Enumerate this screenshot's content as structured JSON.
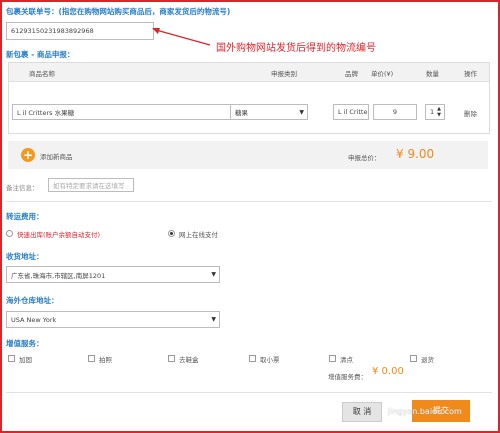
{
  "header": {
    "tracking_label": "包裹关联单号：(指您在购物网站购买商品后，商家发货后的物流号)",
    "tracking_value": "6129315023198389296​8",
    "annotation": "国外购物网站发货后得到的物流编号"
  },
  "package": {
    "section_title": "新包裹 - 商品申报：",
    "columns": [
      "商品名称",
      "申报类别",
      "品牌",
      "单价(¥)",
      "数量",
      "操作"
    ],
    "row": {
      "name": "L il Critters 水果糖",
      "category": "糖果",
      "brand": "L il Critte",
      "price": "9",
      "qty": "1",
      "action": "删除"
    },
    "add_label": "添加新商品",
    "total_label": "申报总价：",
    "total_value": "¥ 9.00"
  },
  "remark": {
    "label": "备注信息：",
    "placeholder": "如有特定要求请在这填写"
  },
  "shipping": {
    "section_title": "转运费用：",
    "option1": "快速出库(账户余额自动支付)",
    "option2": "网上在线支付"
  },
  "address": {
    "section_title": "收货地址：",
    "value": "广东省,珠海市,市辖区,南屏1201"
  },
  "warehouse": {
    "section_title": "海外仓库地址：",
    "value": "USA New York"
  },
  "services": {
    "section_title": "增值服务：",
    "items": [
      "加固",
      "拍照",
      "去鞋盒",
      "取小票",
      "清点",
      "退货"
    ],
    "fee_label": "增值服务费：",
    "fee_value": "¥ 0.00"
  },
  "footer": {
    "cancel": "取 消",
    "submit": "提交",
    "watermark": "jingyan.baidu.com"
  }
}
